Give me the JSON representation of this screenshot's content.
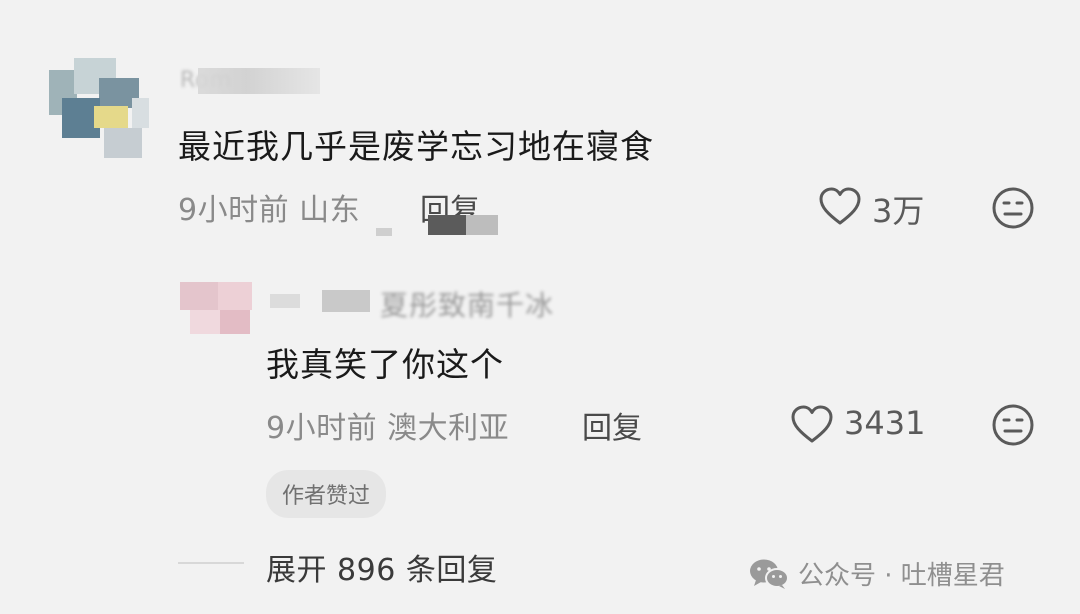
{
  "comment": {
    "author": "Rom",
    "text": "最近我几乎是废学忘习地在寝食",
    "time_location": "9小时前 山东",
    "reply_label": "回复",
    "likes": "3万"
  },
  "reply": {
    "author": "夏彤致南千冰",
    "text": "我真笑了你这个",
    "time_location": "9小时前 澳大利亚",
    "reply_label": "回复",
    "likes": "3431",
    "badge": "作者赞过"
  },
  "expand_label": "展开 896 条回复",
  "watermark": "公众号 · 吐槽星君",
  "icons": {
    "like": "heart-outline-icon",
    "reaction": "neutral-face-icon",
    "wechat": "wechat-logo-icon"
  },
  "colors": {
    "background": "#f2f2f2",
    "text": "#1a1a1a",
    "meta": "#8a8a8a"
  }
}
